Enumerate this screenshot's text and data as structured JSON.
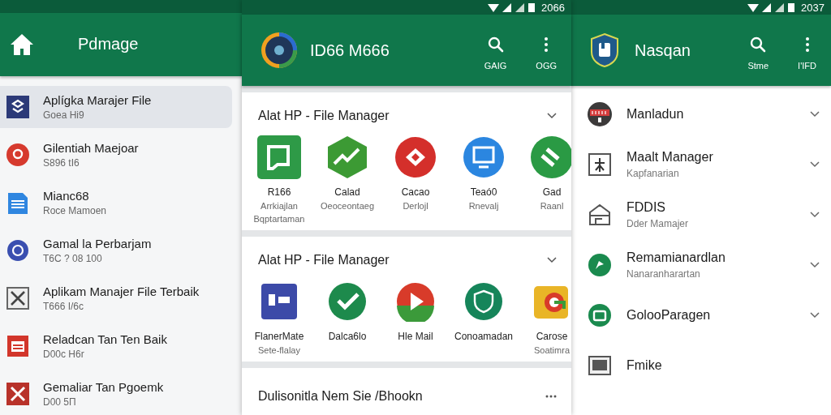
{
  "panels": [
    {
      "appbar": {
        "title": "Pdmage"
      },
      "list": [
        {
          "title": "Aplígka Marajer File",
          "subtitle": "Goea Hi9",
          "selected": true
        },
        {
          "title": "Gilentiah Maejoar",
          "subtitle": "S896 tI6",
          "selected": false
        },
        {
          "title": "Mianc68",
          "subtitle": "Roce Mamoen",
          "selected": false
        },
        {
          "title": "Gamal la Perbarjam",
          "subtitle": "T6C ? 08 100",
          "selected": false
        },
        {
          "title": "Aplikam Manajer File Terbaik",
          "subtitle": "T666 I/6c",
          "selected": false
        },
        {
          "title": "Reladcan Tan Ten Baik",
          "subtitle": "D00c H6r",
          "selected": false
        },
        {
          "title": "Gemaliar Tan Pgoemk",
          "subtitle": "D00 5П",
          "selected": false
        }
      ]
    },
    {
      "status": {
        "time": "2066"
      },
      "appbar": {
        "title": "ID66 M666",
        "actions": [
          {
            "kind": "search",
            "label": "GAIG"
          },
          {
            "kind": "more",
            "label": "OGG"
          }
        ]
      },
      "cards": [
        {
          "title": "Alat HP - File Manager",
          "apps": [
            {
              "lines": [
                "R166",
                "Arrkiajlan",
                "Bqptartaman"
              ]
            },
            {
              "lines": [
                "Calad",
                "Oeoceontaeg"
              ]
            },
            {
              "lines": [
                "Cacao",
                "Derlojl"
              ]
            },
            {
              "lines": [
                "Teaó0",
                "Rnevalj"
              ]
            },
            {
              "lines": [
                "Gad",
                "Raanl"
              ]
            }
          ]
        },
        {
          "title": "Alat HP - File Manager",
          "apps": [
            {
              "lines": [
                "FlanerMate",
                "Sete-flalay"
              ]
            },
            {
              "lines": [
                "Dalca6lo"
              ]
            },
            {
              "lines": [
                "Hle Mail"
              ]
            },
            {
              "lines": [
                "Conoamadan"
              ]
            },
            {
              "lines": [
                "Carose",
                "Soatimra"
              ]
            }
          ]
        }
      ],
      "footer": {
        "title": "Dulisonitla Nem Sie /Bhookn"
      }
    },
    {
      "status": {
        "time": "2037"
      },
      "appbar": {
        "title": "Nasqan",
        "actions": [
          {
            "kind": "search",
            "label": "Stme"
          },
          {
            "kind": "more",
            "label": "I'IFD"
          }
        ]
      },
      "list": [
        {
          "title": "Manladun",
          "expandable": true
        },
        {
          "title": "Maalt Manager",
          "subtitle": "Kapfanarian",
          "expandable": true
        },
        {
          "title": "FDDIS",
          "subtitle": "Dder Mamajer",
          "expandable": true
        },
        {
          "title": "Remamianardlan",
          "subtitle": "Nanaranharartan",
          "expandable": true
        },
        {
          "title": "GolooParagen",
          "expandable": true
        },
        {
          "title": "Fmike",
          "expandable": false
        }
      ]
    }
  ]
}
